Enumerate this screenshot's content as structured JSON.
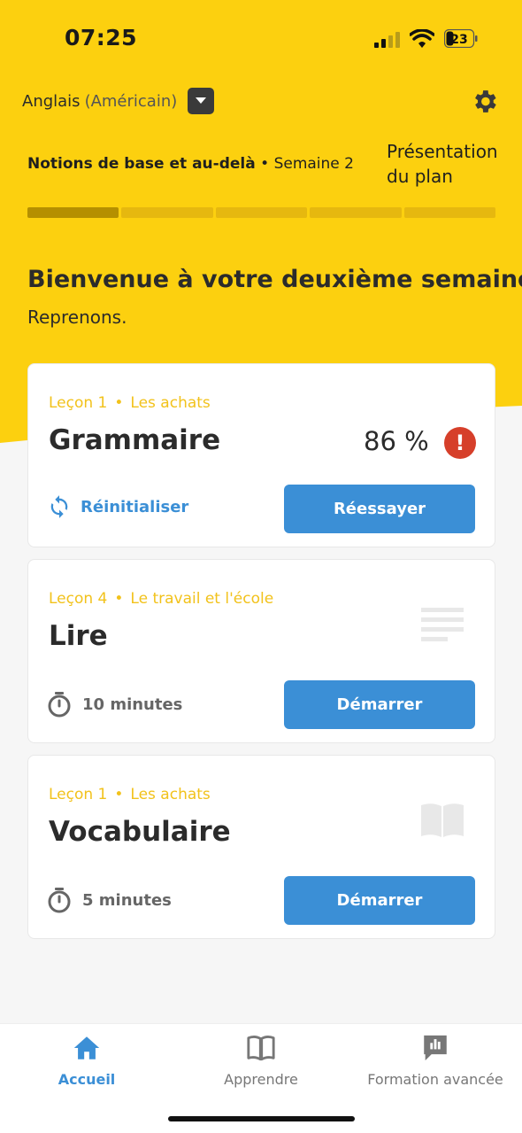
{
  "colors": {
    "brand_yellow": "#fcd00f",
    "accent_blue": "#3b8fd6",
    "alert_red": "#d63f2a",
    "meta_yellow": "#f2c21b"
  },
  "status_bar": {
    "time": "07:25",
    "battery": "23"
  },
  "header": {
    "language": "Anglais",
    "language_variant": "(Américain)",
    "plan_name": "Notions de base et au-delà",
    "plan_separator": "•",
    "week_label": "Semaine 2",
    "overview_link": "Présentation du plan",
    "settings_icon": "gear-icon"
  },
  "progress": {
    "total_segments": 5,
    "completed_fraction": 0.2
  },
  "welcome": {
    "title": "Bienvenue à votre deuxième semaine.",
    "subtitle": "Reprenons."
  },
  "cards": [
    {
      "lesson": "Leçon 1",
      "topic": "Les achats",
      "title": "Grammaire",
      "score": "86 %",
      "secondary": "Réinitialiser",
      "button": "Réessayer",
      "icon": "alert-icon"
    },
    {
      "lesson": "Leçon 4",
      "topic": "Le travail et l'école",
      "title": "Lire",
      "duration": "10 minutes",
      "button": "Démarrer",
      "icon": "document-lines-icon"
    },
    {
      "lesson": "Leçon 1",
      "topic": "Les achats",
      "title": "Vocabulaire",
      "duration": "5 minutes",
      "button": "Démarrer",
      "icon": "open-book-icon"
    }
  ],
  "bottom_nav": [
    {
      "label": "Accueil",
      "icon": "home-icon",
      "active": true
    },
    {
      "label": "Apprendre",
      "icon": "book-icon",
      "active": false
    },
    {
      "label": "Formation avancée",
      "icon": "chat-bars-icon",
      "active": false
    }
  ]
}
